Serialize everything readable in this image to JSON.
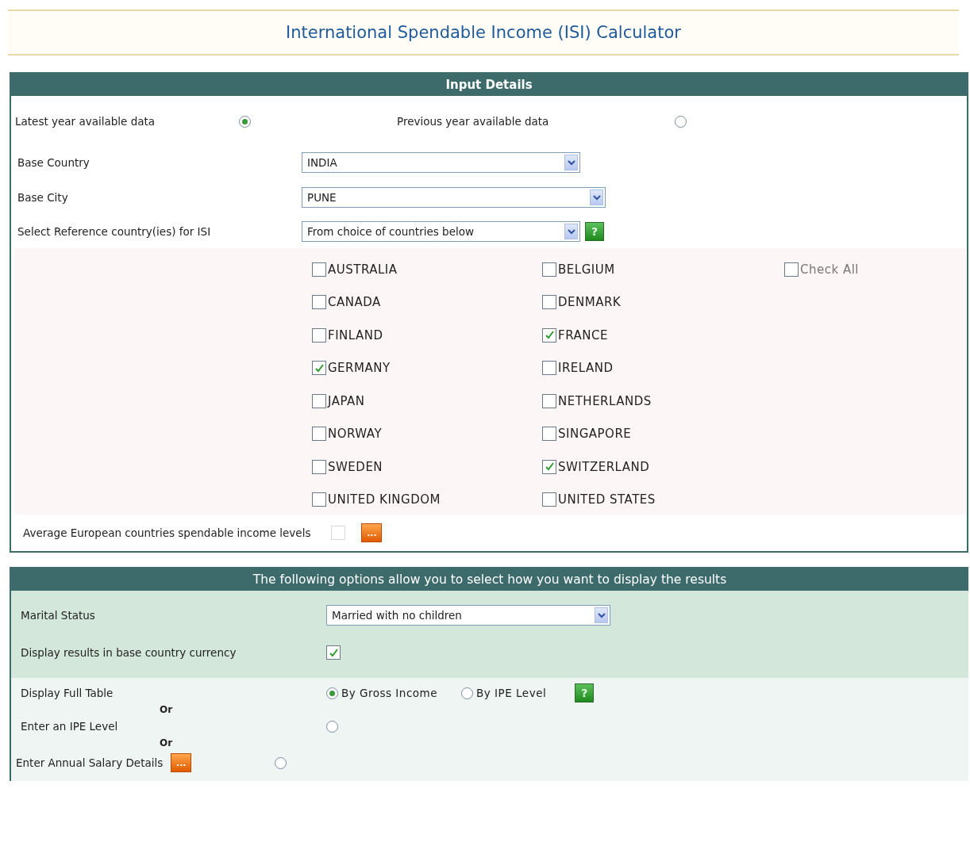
{
  "title": "International Spendable Income (ISI) Calculator",
  "input_panel": {
    "header": "Input Details",
    "data_year": [
      {
        "label": "Latest year available data",
        "selected": true
      },
      {
        "label": "Previous year available data",
        "selected": false
      }
    ],
    "base_country": {
      "label": "Base Country",
      "value": "INDIA"
    },
    "base_city": {
      "label": "Base City",
      "value": "PUNE"
    },
    "reference": {
      "label": "Select Reference country(ies) for ISI",
      "value": "From choice of countries below",
      "help": "?"
    },
    "countries": [
      {
        "label": "AUSTRALIA",
        "checked": false
      },
      {
        "label": "BELGIUM",
        "checked": false
      },
      {
        "label": "CANADA",
        "checked": false
      },
      {
        "label": "DENMARK",
        "checked": false
      },
      {
        "label": "FINLAND",
        "checked": false
      },
      {
        "label": "FRANCE",
        "checked": true
      },
      {
        "label": "GERMANY",
        "checked": true
      },
      {
        "label": "IRELAND",
        "checked": false
      },
      {
        "label": "JAPAN",
        "checked": false
      },
      {
        "label": "NETHERLANDS",
        "checked": false
      },
      {
        "label": "NORWAY",
        "checked": false
      },
      {
        "label": "SINGAPORE",
        "checked": false
      },
      {
        "label": "SWEDEN",
        "checked": false
      },
      {
        "label": "SWITZERLAND",
        "checked": true
      },
      {
        "label": "UNITED KINGDOM",
        "checked": false
      },
      {
        "label": "UNITED STATES",
        "checked": false
      }
    ],
    "check_all": {
      "label": "Check All",
      "checked": false
    },
    "average": {
      "label": "Average European countries spendable income levels",
      "checked": false,
      "more": "..."
    }
  },
  "display_panel": {
    "header": "The following options allow you to select how you want to display the results",
    "marital_status": {
      "label": "Marital Status",
      "value": "Married with no children"
    },
    "currency": {
      "label": "Display results in base country currency",
      "checked": true
    },
    "full_table": {
      "label": "Display Full Table",
      "options": [
        {
          "label": "By Gross Income",
          "selected": true
        },
        {
          "label": "By IPE Level",
          "selected": false
        }
      ],
      "help": "?"
    },
    "separator_1": "Or",
    "ipe_level": {
      "label": "Enter an IPE Level",
      "selected": false
    },
    "separator_2": "Or",
    "salary": {
      "label": "Enter Annual Salary Details",
      "more": "...",
      "selected": false
    }
  }
}
